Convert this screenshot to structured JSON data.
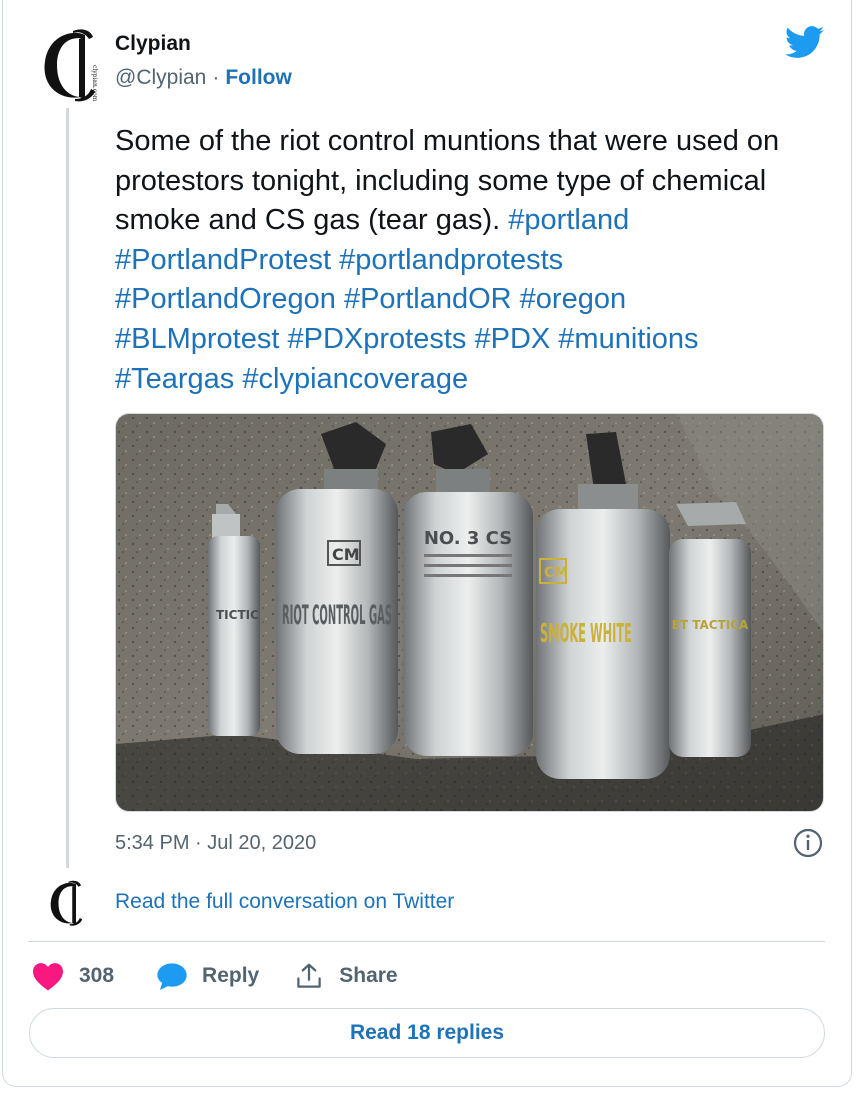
{
  "author": {
    "name": "Clypian",
    "handle": "@Clypian",
    "separator": "·",
    "follow_label": "Follow",
    "avatar_subtext": "clypian.com"
  },
  "tweet": {
    "text_plain": "Some of the riot control muntions that were used on protestors tonight, including some type of chemical smoke and CS gas (tear gas). ",
    "hashtags": [
      "#portland",
      "#PortlandProtest",
      "#portlandprotests",
      "#PortlandOregon",
      "#PortlandOR",
      "#oregon",
      "#BLMprotest",
      "#PDXprotests",
      "#PDX",
      "#munitions",
      "#Teargas",
      "#clypiancoverage"
    ],
    "image_canister_labels": {
      "c2_brand": "CM",
      "c2_label": "RIOT CONTROL GAS",
      "c3_label": "NO. 3 CS",
      "c4_brand": "CM",
      "c4_label": "SMOKE WHITE"
    },
    "timestamp": "5:34 PM · Jul 20, 2020"
  },
  "conversation_link": "Read the full conversation on Twitter",
  "actions": {
    "like_count": "308",
    "reply_label": "Reply",
    "share_label": "Share"
  },
  "read_replies_label": "Read 18 replies",
  "colors": {
    "link_blue": "#1d72b8",
    "twitter_blue": "#1d9bf0",
    "like_pink": "#f91880",
    "muted": "#536471",
    "border": "#cfd9de"
  },
  "icons": {
    "brand": "twitter-bird-icon",
    "info": "info-icon",
    "like": "heart-icon",
    "reply": "speech-bubble-icon",
    "share": "share-upload-icon"
  }
}
